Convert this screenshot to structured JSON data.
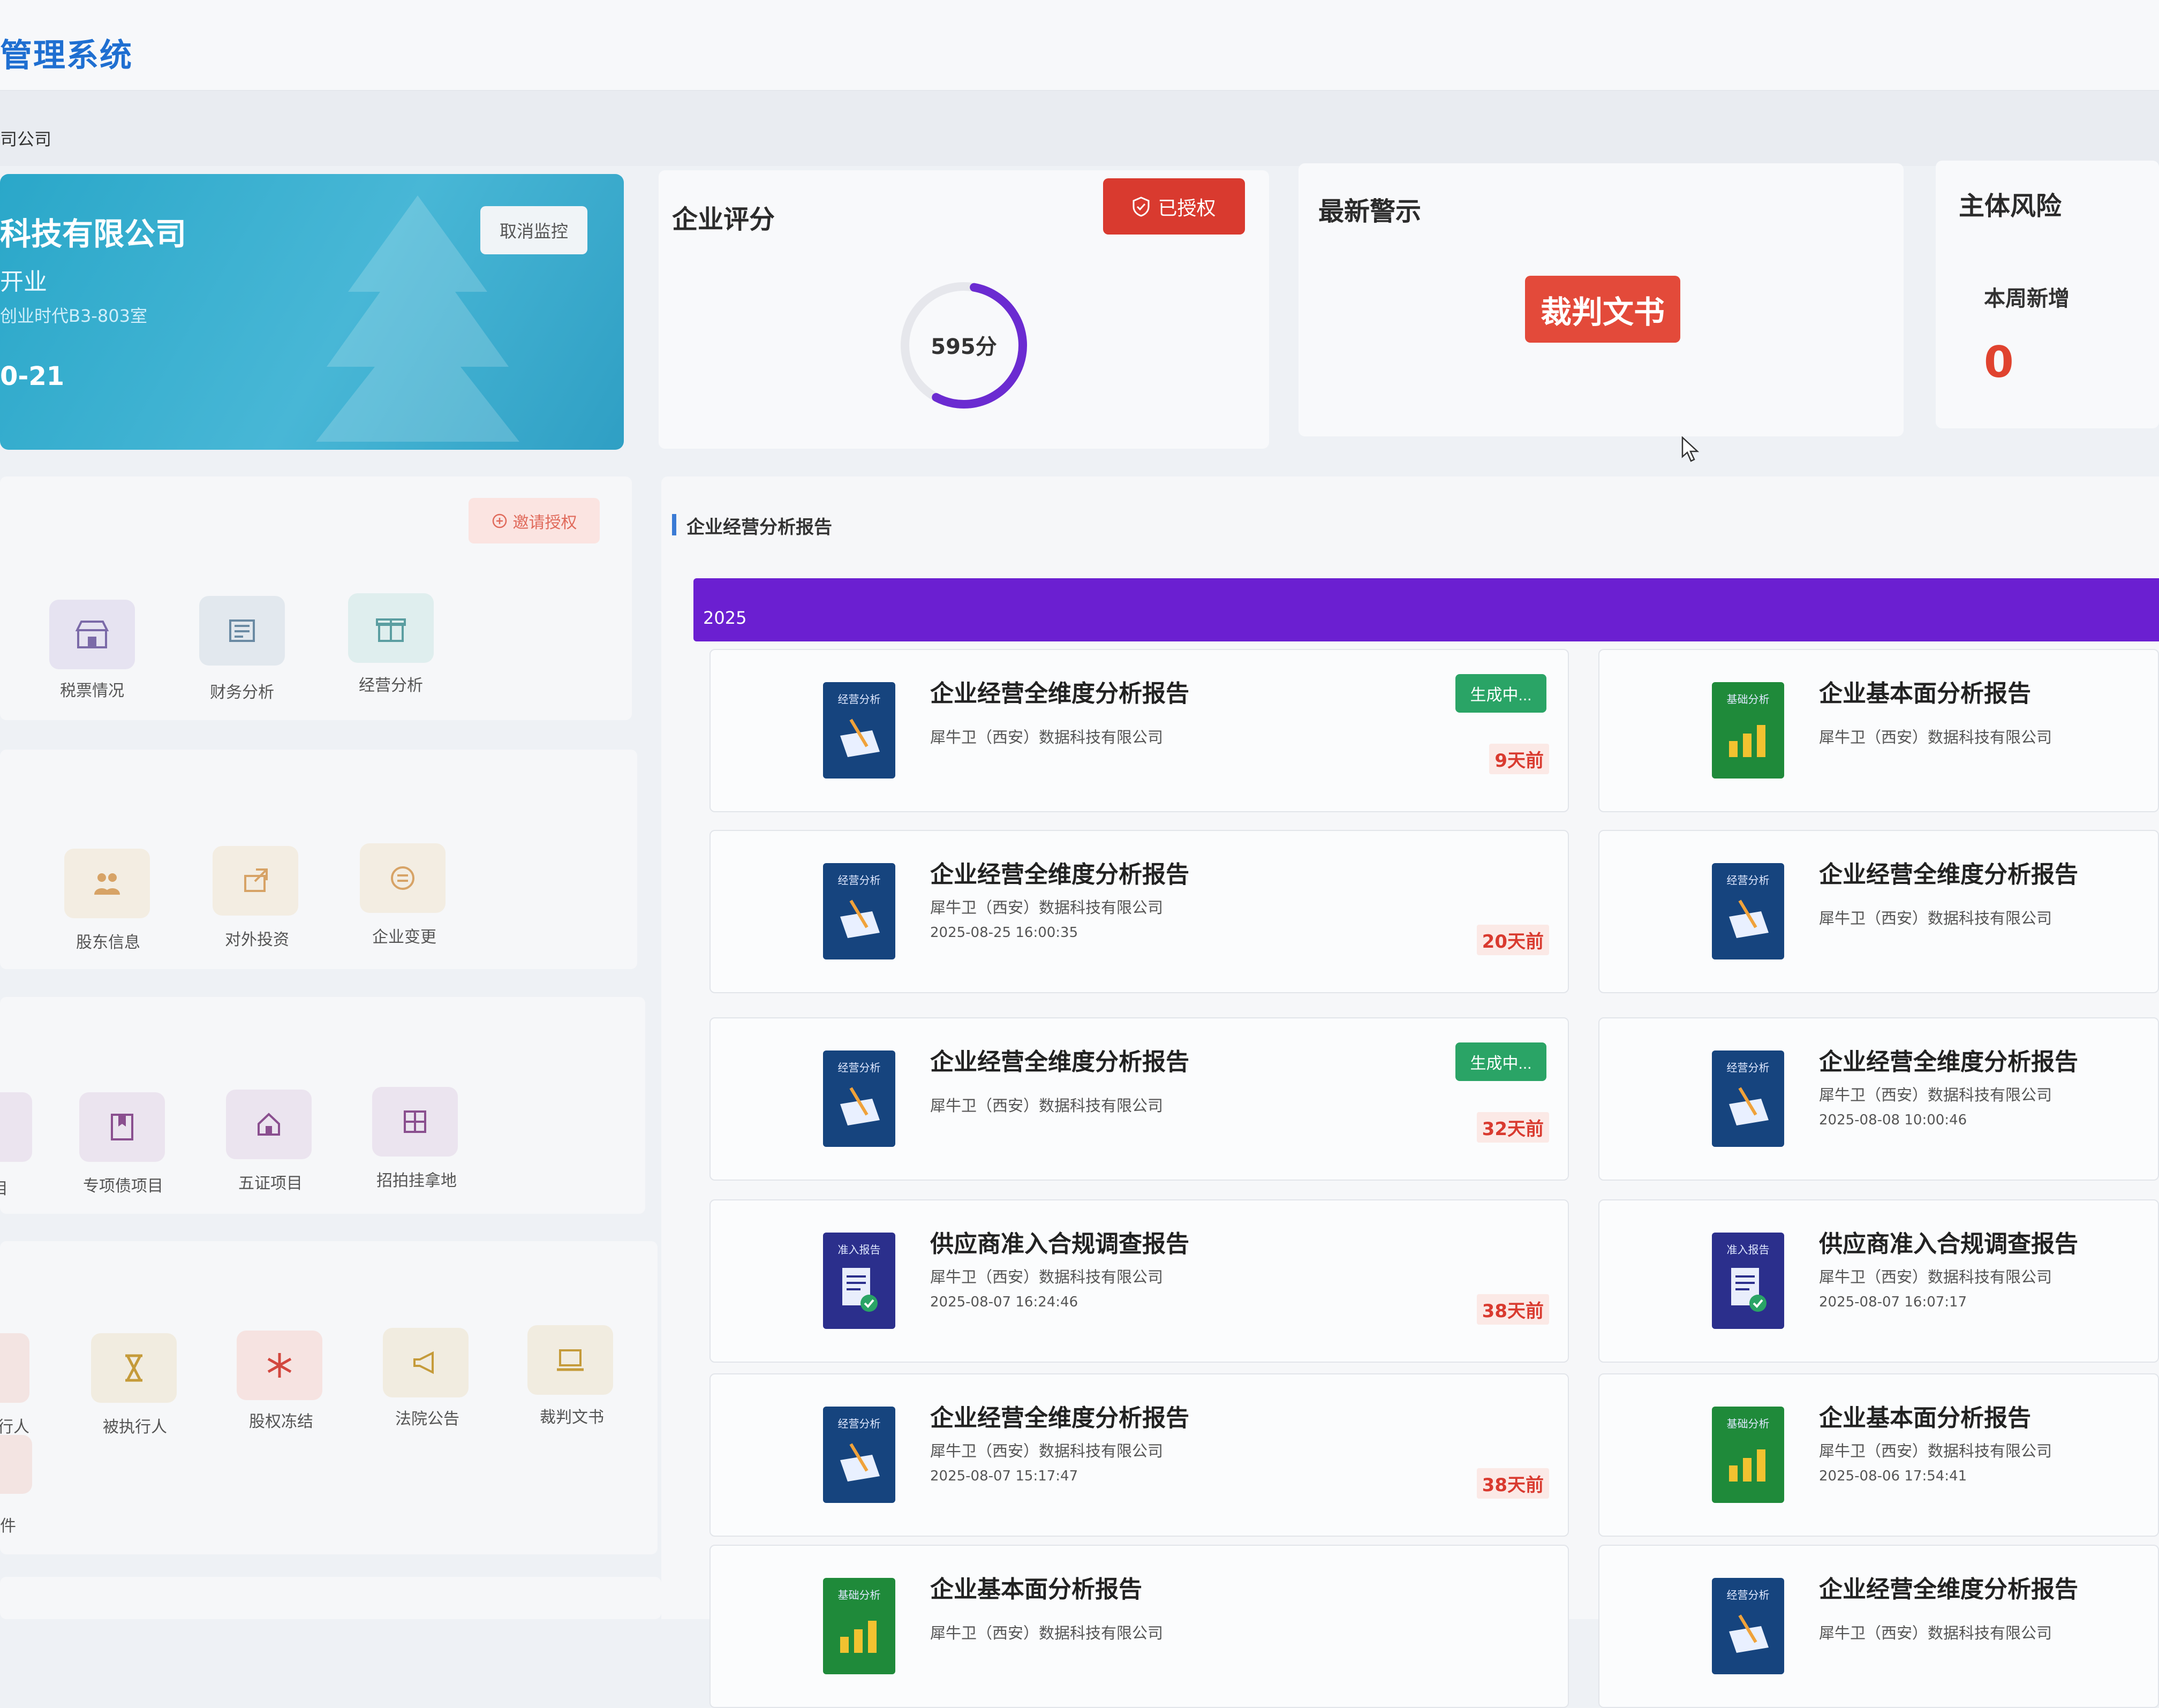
{
  "app": {
    "title": "管理系统",
    "breadcrumb": "司公司"
  },
  "company": {
    "name": "科技有限公司",
    "status": "开业",
    "address": "创业时代B3-803室",
    "date": "0-21",
    "unmonitor_label": "取消监控"
  },
  "score": {
    "title": "企业评分",
    "authorized_label": "已授权",
    "value": "595分",
    "fraction": 0.55
  },
  "alerts": {
    "title": "最新警示",
    "judgement_label": "裁判文书"
  },
  "risk": {
    "title": "主体风险",
    "sub_title": "本周新增",
    "count": "0"
  },
  "panels": {
    "request_label": "邀请授权",
    "group1": [
      "税票情况",
      "财务分析",
      "经营分析"
    ],
    "group2": [
      "股东信息",
      "对外投资",
      "企业变更"
    ],
    "group3": [
      "目",
      "专项债项目",
      "五证项目",
      "招拍挂拿地"
    ],
    "group4": [
      "执行人",
      "被执行人",
      "股权冻结",
      "法院公告",
      "裁判文书"
    ],
    "group4_extra": "案件"
  },
  "reports": {
    "section_title": "企业经营分析报告",
    "year": "2025",
    "generating_label": "生成中...",
    "items": [
      {
        "title": "企业经营全维度分析报告",
        "company": "犀牛卫（西安）数据科技有限公司",
        "time": "",
        "days": "9天前",
        "generating": true,
        "icon": "经营分析"
      },
      {
        "title": "企业基本面分析报告",
        "company": "犀牛卫（西安）数据科技有限公司",
        "time": "",
        "days": "",
        "generating": false,
        "icon": "基础分析"
      },
      {
        "title": "企业经营全维度分析报告",
        "company": "犀牛卫（西安）数据科技有限公司",
        "time": "2025-08-25 16:00:35",
        "days": "20天前",
        "generating": false,
        "icon": "经营分析"
      },
      {
        "title": "企业经营全维度分析报告",
        "company": "犀牛卫（西安）数据科技有限公司",
        "time": "",
        "days": "",
        "generating": false,
        "icon": "经营分析"
      },
      {
        "title": "企业经营全维度分析报告",
        "company": "犀牛卫（西安）数据科技有限公司",
        "time": "",
        "days": "32天前",
        "generating": true,
        "icon": "经营分析"
      },
      {
        "title": "企业经营全维度分析报告",
        "company": "犀牛卫（西安）数据科技有限公司",
        "time": "2025-08-08 10:00:46",
        "days": "",
        "generating": false,
        "icon": "经营分析"
      },
      {
        "title": "供应商准入合规调查报告",
        "company": "犀牛卫（西安）数据科技有限公司",
        "time": "2025-08-07 16:24:46",
        "days": "38天前",
        "generating": false,
        "icon": "准入报告"
      },
      {
        "title": "供应商准入合规调查报告",
        "company": "犀牛卫（西安）数据科技有限公司",
        "time": "2025-08-07 16:07:17",
        "days": "",
        "generating": false,
        "icon": "准入报告"
      },
      {
        "title": "企业经营全维度分析报告",
        "company": "犀牛卫（西安）数据科技有限公司",
        "time": "2025-08-07 15:17:47",
        "days": "38天前",
        "generating": false,
        "icon": "经营分析"
      },
      {
        "title": "企业基本面分析报告",
        "company": "犀牛卫（西安）数据科技有限公司",
        "time": "2025-08-06 17:54:41",
        "days": "",
        "generating": false,
        "icon": "基础分析"
      },
      {
        "title": "企业基本面分析报告",
        "company": "犀牛卫（西安）数据科技有限公司",
        "time": "",
        "days": "",
        "generating": false,
        "icon": "基础分析"
      },
      {
        "title": "企业经营全维度分析报告",
        "company": "犀牛卫（西安）数据科技有限公司",
        "time": "",
        "days": "",
        "generating": false,
        "icon": "经营分析"
      }
    ]
  },
  "colors": {
    "brand": "#1f6fd1",
    "danger": "#d93a2f",
    "success": "#2aa466",
    "year_bar": "#6b1fd1",
    "company_card": "#2aa7c9"
  }
}
